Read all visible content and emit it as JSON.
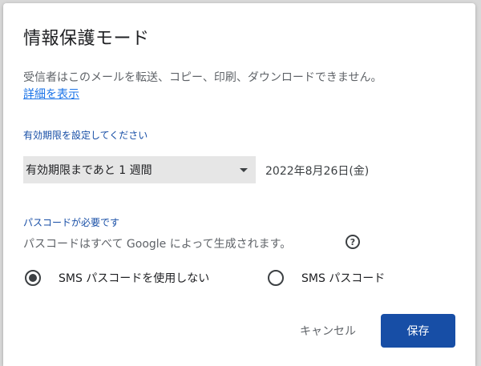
{
  "dialog": {
    "title": "情報保護モード",
    "description": "受信者はこのメールを転送、コピー、印刷、ダウンロードできません。",
    "details_link": "詳細を表示"
  },
  "expiry": {
    "label": "有効期限を設定してください",
    "selected": "有効期限まであと 1 週間",
    "date": "2022年8月26日(金)"
  },
  "passcode": {
    "label": "パスコードが必要です",
    "description": "パスコードはすべて Google によって生成されます。",
    "help_icon": "?",
    "options": [
      {
        "label": "SMS パスコードを使用しない",
        "checked": true
      },
      {
        "label": "SMS パスコード",
        "checked": false
      }
    ]
  },
  "buttons": {
    "cancel": "キャンセル",
    "save": "保存"
  },
  "colors": {
    "primary": "#174ea6",
    "link": "#1a73e8",
    "text": "#202124",
    "secondary_text": "#5f6368"
  }
}
